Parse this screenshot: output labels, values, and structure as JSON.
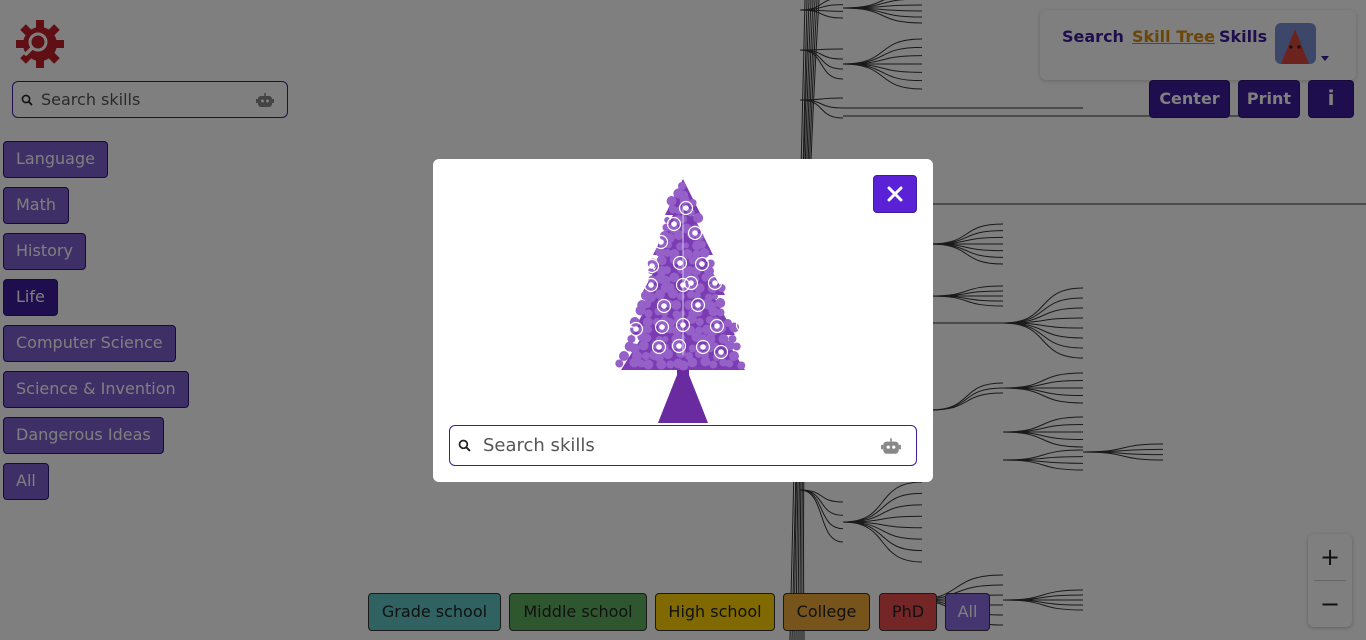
{
  "sidebar": {
    "logo": "gear-search-logo-icon",
    "search": {
      "placeholder": "Search skills",
      "icon": "search-icon",
      "ai_icon": "robot-icon"
    },
    "categories": [
      {
        "label": "Language",
        "active": false
      },
      {
        "label": "Math",
        "active": false
      },
      {
        "label": "History",
        "active": false
      },
      {
        "label": "Life",
        "active": true
      },
      {
        "label": "Computer Science",
        "active": false
      },
      {
        "label": "Science & Invention",
        "active": false
      },
      {
        "label": "Dangerous Ideas",
        "active": false
      },
      {
        "label": "All",
        "active": false
      }
    ]
  },
  "nav": {
    "links": [
      {
        "label": "Search",
        "current": false
      },
      {
        "label": "Skill Tree",
        "current": true
      },
      {
        "label": "Skills",
        "current": false
      }
    ],
    "avatar": "avatar-icon"
  },
  "toolbar": {
    "center_label": "Center",
    "print_label": "Print",
    "info_label": "i"
  },
  "grades": [
    {
      "label": "Grade school",
      "color": "#5ec4c0"
    },
    {
      "label": "Middle school",
      "color": "#5fae5f"
    },
    {
      "label": "High school",
      "color": "#ffd200"
    },
    {
      "label": "College",
      "color": "#f0a93b"
    },
    {
      "label": "PhD",
      "color": "#e84c4c"
    },
    {
      "label": "All",
      "color": "#8a6be0"
    }
  ],
  "zoom": {
    "in_label": "+",
    "out_label": "−"
  },
  "modal": {
    "image": "skill-tree-illustration",
    "search": {
      "placeholder": "Search skills",
      "icon": "search-icon",
      "ai_icon": "robot-icon"
    },
    "close_icon": "close-icon"
  },
  "colors": {
    "accent": "#3d1d9c",
    "category": "#7c5fcf",
    "logo": "#c0202a",
    "link_current": "#d98a12"
  }
}
